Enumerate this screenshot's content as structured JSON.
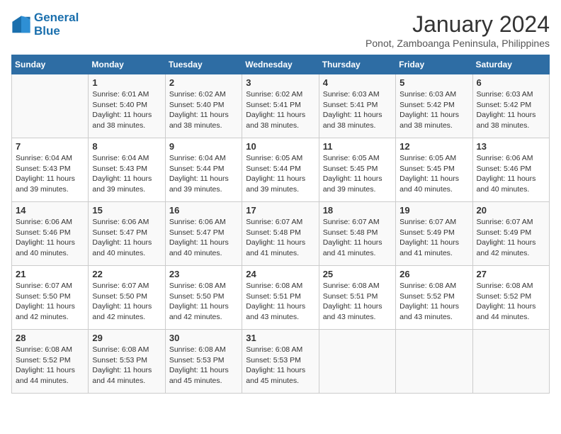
{
  "header": {
    "logo_line1": "General",
    "logo_line2": "Blue",
    "month_title": "January 2024",
    "subtitle": "Ponot, Zamboanga Peninsula, Philippines"
  },
  "days_of_week": [
    "Sunday",
    "Monday",
    "Tuesday",
    "Wednesday",
    "Thursday",
    "Friday",
    "Saturday"
  ],
  "weeks": [
    [
      {
        "day": "",
        "sunrise": "",
        "sunset": "",
        "daylight": ""
      },
      {
        "day": "1",
        "sunrise": "Sunrise: 6:01 AM",
        "sunset": "Sunset: 5:40 PM",
        "daylight": "Daylight: 11 hours and 38 minutes."
      },
      {
        "day": "2",
        "sunrise": "Sunrise: 6:02 AM",
        "sunset": "Sunset: 5:40 PM",
        "daylight": "Daylight: 11 hours and 38 minutes."
      },
      {
        "day": "3",
        "sunrise": "Sunrise: 6:02 AM",
        "sunset": "Sunset: 5:41 PM",
        "daylight": "Daylight: 11 hours and 38 minutes."
      },
      {
        "day": "4",
        "sunrise": "Sunrise: 6:03 AM",
        "sunset": "Sunset: 5:41 PM",
        "daylight": "Daylight: 11 hours and 38 minutes."
      },
      {
        "day": "5",
        "sunrise": "Sunrise: 6:03 AM",
        "sunset": "Sunset: 5:42 PM",
        "daylight": "Daylight: 11 hours and 38 minutes."
      },
      {
        "day": "6",
        "sunrise": "Sunrise: 6:03 AM",
        "sunset": "Sunset: 5:42 PM",
        "daylight": "Daylight: 11 hours and 38 minutes."
      }
    ],
    [
      {
        "day": "7",
        "sunrise": "Sunrise: 6:04 AM",
        "sunset": "Sunset: 5:43 PM",
        "daylight": "Daylight: 11 hours and 39 minutes."
      },
      {
        "day": "8",
        "sunrise": "Sunrise: 6:04 AM",
        "sunset": "Sunset: 5:43 PM",
        "daylight": "Daylight: 11 hours and 39 minutes."
      },
      {
        "day": "9",
        "sunrise": "Sunrise: 6:04 AM",
        "sunset": "Sunset: 5:44 PM",
        "daylight": "Daylight: 11 hours and 39 minutes."
      },
      {
        "day": "10",
        "sunrise": "Sunrise: 6:05 AM",
        "sunset": "Sunset: 5:44 PM",
        "daylight": "Daylight: 11 hours and 39 minutes."
      },
      {
        "day": "11",
        "sunrise": "Sunrise: 6:05 AM",
        "sunset": "Sunset: 5:45 PM",
        "daylight": "Daylight: 11 hours and 39 minutes."
      },
      {
        "day": "12",
        "sunrise": "Sunrise: 6:05 AM",
        "sunset": "Sunset: 5:45 PM",
        "daylight": "Daylight: 11 hours and 40 minutes."
      },
      {
        "day": "13",
        "sunrise": "Sunrise: 6:06 AM",
        "sunset": "Sunset: 5:46 PM",
        "daylight": "Daylight: 11 hours and 40 minutes."
      }
    ],
    [
      {
        "day": "14",
        "sunrise": "Sunrise: 6:06 AM",
        "sunset": "Sunset: 5:46 PM",
        "daylight": "Daylight: 11 hours and 40 minutes."
      },
      {
        "day": "15",
        "sunrise": "Sunrise: 6:06 AM",
        "sunset": "Sunset: 5:47 PM",
        "daylight": "Daylight: 11 hours and 40 minutes."
      },
      {
        "day": "16",
        "sunrise": "Sunrise: 6:06 AM",
        "sunset": "Sunset: 5:47 PM",
        "daylight": "Daylight: 11 hours and 40 minutes."
      },
      {
        "day": "17",
        "sunrise": "Sunrise: 6:07 AM",
        "sunset": "Sunset: 5:48 PM",
        "daylight": "Daylight: 11 hours and 41 minutes."
      },
      {
        "day": "18",
        "sunrise": "Sunrise: 6:07 AM",
        "sunset": "Sunset: 5:48 PM",
        "daylight": "Daylight: 11 hours and 41 minutes."
      },
      {
        "day": "19",
        "sunrise": "Sunrise: 6:07 AM",
        "sunset": "Sunset: 5:49 PM",
        "daylight": "Daylight: 11 hours and 41 minutes."
      },
      {
        "day": "20",
        "sunrise": "Sunrise: 6:07 AM",
        "sunset": "Sunset: 5:49 PM",
        "daylight": "Daylight: 11 hours and 42 minutes."
      }
    ],
    [
      {
        "day": "21",
        "sunrise": "Sunrise: 6:07 AM",
        "sunset": "Sunset: 5:50 PM",
        "daylight": "Daylight: 11 hours and 42 minutes."
      },
      {
        "day": "22",
        "sunrise": "Sunrise: 6:07 AM",
        "sunset": "Sunset: 5:50 PM",
        "daylight": "Daylight: 11 hours and 42 minutes."
      },
      {
        "day": "23",
        "sunrise": "Sunrise: 6:08 AM",
        "sunset": "Sunset: 5:50 PM",
        "daylight": "Daylight: 11 hours and 42 minutes."
      },
      {
        "day": "24",
        "sunrise": "Sunrise: 6:08 AM",
        "sunset": "Sunset: 5:51 PM",
        "daylight": "Daylight: 11 hours and 43 minutes."
      },
      {
        "day": "25",
        "sunrise": "Sunrise: 6:08 AM",
        "sunset": "Sunset: 5:51 PM",
        "daylight": "Daylight: 11 hours and 43 minutes."
      },
      {
        "day": "26",
        "sunrise": "Sunrise: 6:08 AM",
        "sunset": "Sunset: 5:52 PM",
        "daylight": "Daylight: 11 hours and 43 minutes."
      },
      {
        "day": "27",
        "sunrise": "Sunrise: 6:08 AM",
        "sunset": "Sunset: 5:52 PM",
        "daylight": "Daylight: 11 hours and 44 minutes."
      }
    ],
    [
      {
        "day": "28",
        "sunrise": "Sunrise: 6:08 AM",
        "sunset": "Sunset: 5:52 PM",
        "daylight": "Daylight: 11 hours and 44 minutes."
      },
      {
        "day": "29",
        "sunrise": "Sunrise: 6:08 AM",
        "sunset": "Sunset: 5:53 PM",
        "daylight": "Daylight: 11 hours and 44 minutes."
      },
      {
        "day": "30",
        "sunrise": "Sunrise: 6:08 AM",
        "sunset": "Sunset: 5:53 PM",
        "daylight": "Daylight: 11 hours and 45 minutes."
      },
      {
        "day": "31",
        "sunrise": "Sunrise: 6:08 AM",
        "sunset": "Sunset: 5:53 PM",
        "daylight": "Daylight: 11 hours and 45 minutes."
      },
      {
        "day": "",
        "sunrise": "",
        "sunset": "",
        "daylight": ""
      },
      {
        "day": "",
        "sunrise": "",
        "sunset": "",
        "daylight": ""
      },
      {
        "day": "",
        "sunrise": "",
        "sunset": "",
        "daylight": ""
      }
    ]
  ]
}
